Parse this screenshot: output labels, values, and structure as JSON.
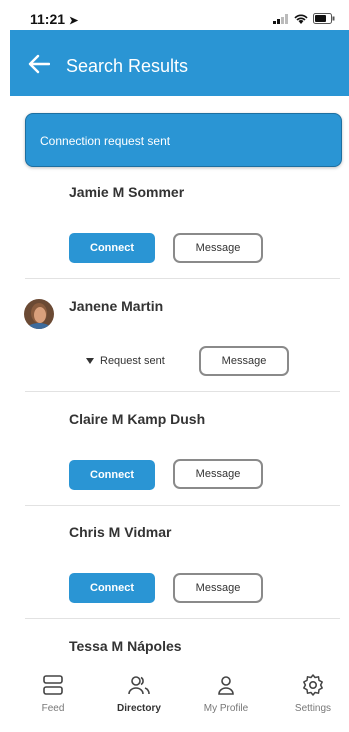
{
  "status": {
    "time": "11:21"
  },
  "header": {
    "title": "Search Results"
  },
  "toast": {
    "text": "Connection request sent"
  },
  "people": [
    {
      "name": "Jamie M Sommer",
      "connect_label": "Connect",
      "message_label": "Message"
    },
    {
      "name": "Janene Martin",
      "request_label": "Request sent",
      "message_label": "Message"
    },
    {
      "name": "Claire M Kamp Dush",
      "connect_label": "Connect",
      "message_label": "Message"
    },
    {
      "name": "Chris M Vidmar",
      "connect_label": "Connect",
      "message_label": "Message"
    },
    {
      "name": "Tessa M Nápoles"
    }
  ],
  "tabs": [
    {
      "label": "Feed",
      "icon": "feed-icon"
    },
    {
      "label": "Directory",
      "icon": "people-icon",
      "active": true
    },
    {
      "label": "My Profile",
      "icon": "person-icon"
    },
    {
      "label": "Settings",
      "icon": "gear-icon"
    }
  ],
  "colors": {
    "accent": "#2a95d4"
  }
}
